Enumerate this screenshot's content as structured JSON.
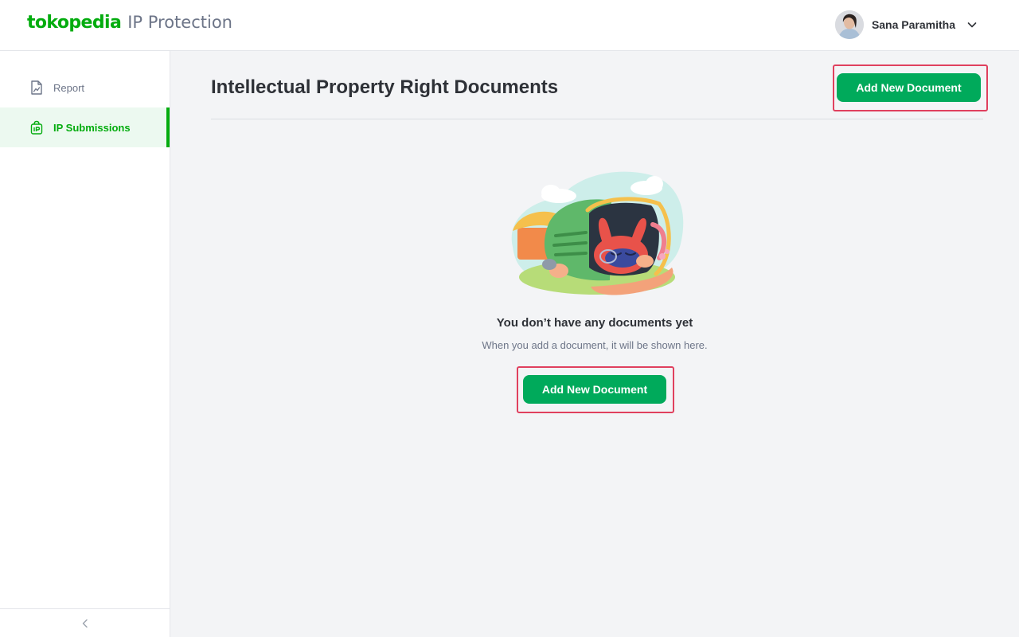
{
  "header": {
    "brand_logo": "tokopedia",
    "brand_product": "IP Protection",
    "user_name": "Sana Paramitha",
    "avatar_icon": "user-avatar",
    "menu_icon": "chevron-down-icon"
  },
  "sidebar": {
    "items": [
      {
        "label": "Report",
        "icon": "document-chart-icon",
        "active": false
      },
      {
        "label": "IP Submissions",
        "icon": "ip-bag-icon",
        "active": true
      }
    ],
    "collapse_icon": "chevron-left-icon"
  },
  "main": {
    "title": "Intellectual Property Right Documents",
    "add_button_label": "Add New Document",
    "empty_state": {
      "title": "You don’t have any documents yet",
      "subtitle": "When you add a document, it will be shown here.",
      "button_label": "Add New Document"
    }
  },
  "colors": {
    "brand_green": "#03ac0e",
    "button_green": "#00aa5b",
    "highlight": "#e0405e"
  }
}
